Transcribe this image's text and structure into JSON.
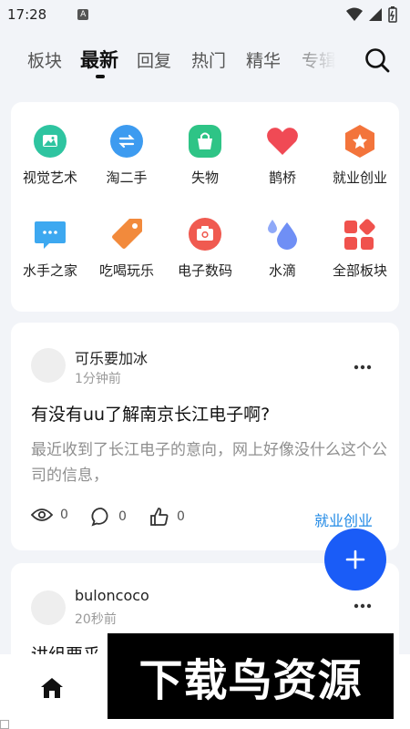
{
  "status": {
    "time": "17:28",
    "a_badge": "A"
  },
  "tabs": [
    {
      "label": "板块",
      "active": false
    },
    {
      "label": "最新",
      "active": true
    },
    {
      "label": "回复",
      "active": false
    },
    {
      "label": "热门",
      "active": false
    },
    {
      "label": "精华",
      "active": false
    },
    {
      "label": "专辑",
      "active": false
    }
  ],
  "categories": [
    {
      "label": "视觉艺术",
      "icon": "image-icon",
      "color": "#2ec4a0"
    },
    {
      "label": "淘二手",
      "icon": "exchange-icon",
      "color": "#3d9bf0"
    },
    {
      "label": "失物",
      "icon": "bag-icon",
      "color": "#2ec486"
    },
    {
      "label": "鹊桥",
      "icon": "heart-icon",
      "color": "#f04a55"
    },
    {
      "label": "就业创业",
      "icon": "star-hexagon-icon",
      "color": "#f3743b"
    },
    {
      "label": "水手之家",
      "icon": "chat-bubble-icon",
      "color": "#3da8f0"
    },
    {
      "label": "吃喝玩乐",
      "icon": "tag-icon",
      "color": "#f28a3c"
    },
    {
      "label": "电子数码",
      "icon": "camera-icon",
      "color": "#f05a50"
    },
    {
      "label": "水滴",
      "icon": "water-drops-icon",
      "color": "#6f8ff5"
    },
    {
      "label": "全部板块",
      "icon": "grid-blocks-icon",
      "color": "#f0524d"
    }
  ],
  "posts": [
    {
      "author": "可乐要加冰",
      "time": "1分钟前",
      "title": "有没有uu了解南京长江电子啊?",
      "excerpt": "最近收到了长江电子的意向，网上好像没什么这个公司的信息，",
      "views": "0",
      "comments": "0",
      "likes": "0",
      "tag": "就业创业"
    },
    {
      "author": "buloncoco",
      "time": "20秒前",
      "title": "讲组要乎"
    }
  ],
  "watermark": "下载鸟资源",
  "colors": {
    "accent": "#1a5cf7",
    "tag": "#1e88e5"
  }
}
